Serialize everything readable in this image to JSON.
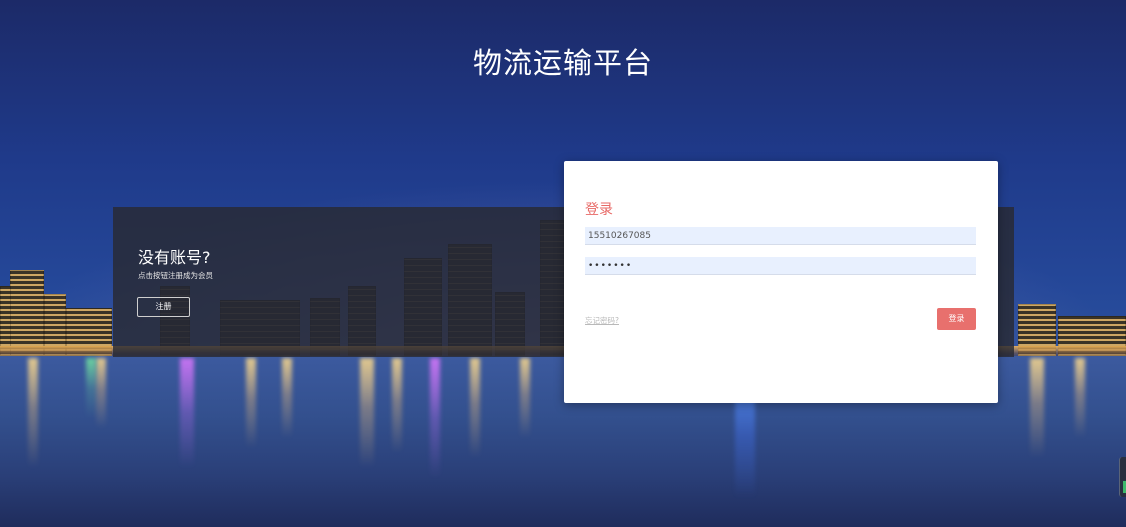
{
  "page": {
    "title": "物流运输平台"
  },
  "register_panel": {
    "heading": "没有账号?",
    "hint": "点击按钮注册成为会员",
    "register_label": "注册"
  },
  "login": {
    "heading": "登录",
    "phone_value": "15510267085",
    "password_value": "•••••••",
    "forgot_label": "忘记密码?",
    "submit_label": "登录"
  },
  "colors": {
    "accent": "#e8706d",
    "heading": "#e86a67",
    "input_bg": "#e8f0fe"
  }
}
